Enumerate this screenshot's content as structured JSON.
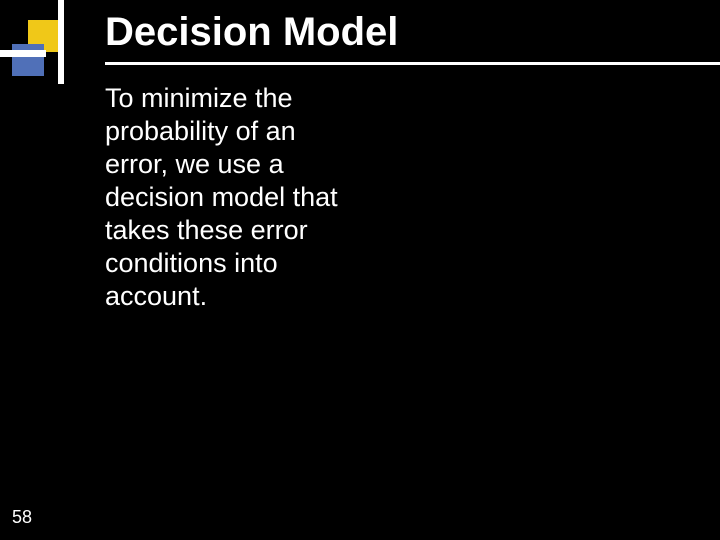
{
  "slide": {
    "title": "Decision Model",
    "body": "To minimize the probability of an error, we use a decision model that takes these error conditions into account.",
    "page_number": "58"
  },
  "colors": {
    "background": "#000000",
    "text": "#FFFFFF",
    "logo_yellow": "#F0C818",
    "logo_blue": "#5070B8"
  }
}
